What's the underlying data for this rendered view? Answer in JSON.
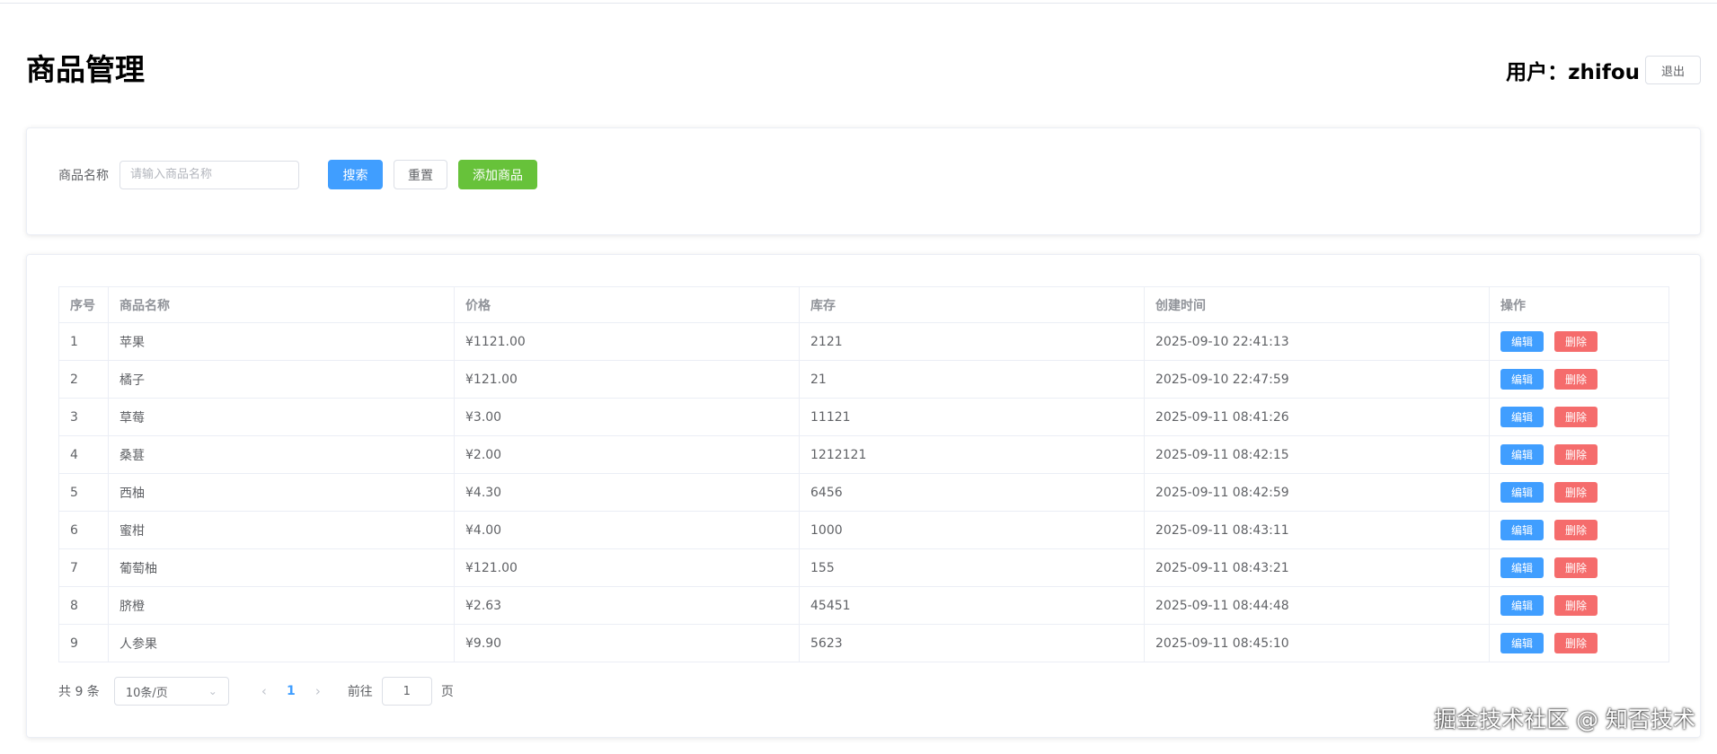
{
  "header": {
    "title": "商品管理",
    "user_label": "用户：zhifou",
    "logout_label": "退出"
  },
  "search": {
    "label": "商品名称",
    "placeholder": "请输入商品名称",
    "value": "",
    "search_label": "搜索",
    "reset_label": "重置",
    "add_label": "添加商品"
  },
  "table": {
    "columns": [
      "序号",
      "商品名称",
      "价格",
      "库存",
      "创建时间",
      "操作"
    ],
    "edit_label": "编辑",
    "delete_label": "删除",
    "rows": [
      {
        "id": "1",
        "name": "苹果",
        "price": "¥1121.00",
        "stock": "2121",
        "created": "2025-09-10 22:41:13"
      },
      {
        "id": "2",
        "name": "橘子",
        "price": "¥121.00",
        "stock": "21",
        "created": "2025-09-10 22:47:59"
      },
      {
        "id": "3",
        "name": "草莓",
        "price": "¥3.00",
        "stock": "11121",
        "created": "2025-09-11 08:41:26"
      },
      {
        "id": "4",
        "name": "桑葚",
        "price": "¥2.00",
        "stock": "1212121",
        "created": "2025-09-11 08:42:15"
      },
      {
        "id": "5",
        "name": "西柚",
        "price": "¥4.30",
        "stock": "6456",
        "created": "2025-09-11 08:42:59"
      },
      {
        "id": "6",
        "name": "蜜柑",
        "price": "¥4.00",
        "stock": "1000",
        "created": "2025-09-11 08:43:11"
      },
      {
        "id": "7",
        "name": "葡萄柚",
        "price": "¥121.00",
        "stock": "155",
        "created": "2025-09-11 08:43:21"
      },
      {
        "id": "8",
        "name": "脐橙",
        "price": "¥2.63",
        "stock": "45451",
        "created": "2025-09-11 08:44:48"
      },
      {
        "id": "9",
        "name": "人参果",
        "price": "¥9.90",
        "stock": "5623",
        "created": "2025-09-11 08:45:10"
      }
    ]
  },
  "pagination": {
    "total_label": "共 9 条",
    "page_size_label": "10条/页",
    "current_page": "1",
    "goto_label": "前往",
    "goto_value": "1",
    "page_suffix": "页",
    "prev_icon": "chevron-left-icon",
    "next_icon": "chevron-right-icon"
  },
  "watermark": "掘金技术社区 @ 知否技术",
  "colors": {
    "primary": "#409eff",
    "success": "#67c23a",
    "danger": "#f56c6c",
    "border": "#ebeef5",
    "text": "#606266",
    "header_text": "#909399"
  }
}
